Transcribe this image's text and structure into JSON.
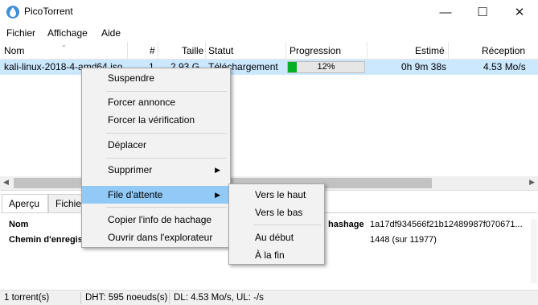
{
  "window": {
    "title": "PicoTorrent",
    "minimize_glyph": "—",
    "maximize_glyph": "☐",
    "close_glyph": "✕",
    "icon": "picotorrent-logo-icon"
  },
  "menubar": {
    "items": [
      "Fichier",
      "Affichage",
      "Aide"
    ]
  },
  "list": {
    "columns": [
      "Nom",
      "#",
      "Taille",
      "Statut",
      "Progression",
      "Estimé",
      "Réception"
    ],
    "rows": [
      {
        "name": "kali-linux-2018-4-amd64.iso",
        "queue": "1",
        "size": "2.93 G",
        "status": "Téléchargement",
        "progress_text": "12%",
        "progress_value": 0.12,
        "eta": "0h 9m 38s",
        "download": "4.53 Mo/s"
      }
    ]
  },
  "details": {
    "tabs": [
      "Aperçu",
      "Fichiers"
    ],
    "active_tab": "Aperçu",
    "labels": {
      "name": "Nom",
      "save_path": "Chemin d'enregistrement",
      "hash": "hashage",
      "pieces": ""
    },
    "hash_value": "1a17df934566f21b12489987f070671...",
    "pieces_value": "1448 (sur 11977)"
  },
  "statusbar": {
    "torrents": "1 torrent(s)",
    "dht": "DHT: 595 noeuds(s)",
    "rates": "DL: 4.53 Mo/s, UL: -/s"
  },
  "context_menu": {
    "items": [
      {
        "label": "Suspendre"
      },
      {
        "label": "Forcer annonce"
      },
      {
        "label": "Forcer la vérification"
      },
      {
        "label": "Déplacer"
      },
      {
        "label": "Supprimer",
        "submenu": true
      },
      {
        "label": "File d'attente",
        "submenu": true,
        "highlighted": true
      },
      {
        "label": "Copier l'info de hachage"
      },
      {
        "label": "Ouvrir dans l'explorateur"
      }
    ],
    "arrow_glyph": "▶"
  },
  "submenu": {
    "items": [
      "Vers le haut",
      "Vers le bas",
      "Au début",
      "À la fin"
    ]
  },
  "colors": {
    "selection": "#cce8ff",
    "menu_highlight": "#91c9f7",
    "progress_fill": "#06b025"
  }
}
